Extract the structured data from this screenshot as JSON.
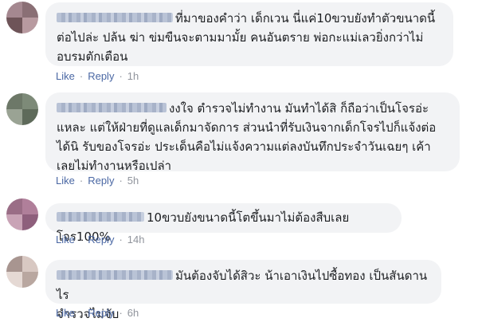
{
  "comments": [
    {
      "text": "ที่มาของคำว่า เด็กเวน นี่แค่10ขวบยังทำตัวขนาดนี้ ต่อไปล่ะ ปล้น ฆ่า ข่มขืนจะตามมามั้ย คนอันตราย พ่อกะแม่เลวยิ่งกว่าไม่อบรมตักเตือน",
      "like": "Like",
      "reply": "Reply",
      "time": "1h"
    },
    {
      "text": "งงใจ ตำรวจไม่ทำงาน มันทำได้สิ ก็ถือว่าเป็นโจรอ่ะ แหละ แต่ให้ฝ่ายที่ดูแลเด็กมาจัดการ ส่วนนำที่รับเงินจากเด็กโจรไปก็แจ้งต่อได้นิ รับของโจรอ่ะ ประเด็นคือไม่แจ้งความแต่ลงบันทึกประจำวันเฉยๆ เค้าเลยไม่ทำงานหรือเปล่า",
      "like": "Like",
      "reply": "Reply",
      "time": "5h"
    },
    {
      "text": "10ขวบยังขนาดนี้โตขึ้นมาไม่ต้องสืบเลยโจร100%",
      "like": "Like",
      "reply": "Reply",
      "time": "14h"
    },
    {
      "text": "มันต้องจับได้สิวะ น้าเอาเงินไปซื้อทอง เป็นสันดานไร จำรวจไม่จับ",
      "like": "Like",
      "reply": "Reply",
      "time": "6h"
    }
  ],
  "lines": {
    "c0": [
      "ที่มาของคำว่า เด็กเวน นี่แค่10ขวบยังทำตัวขนาดนี้",
      "ต่อไปล่ะ ปล้น ฆ่า ข่มขืนจะตามมามั้ย คนอันตราย พ่อกะแม่เลวยิ่งกว่าไม่",
      "อบรมตักเตือน"
    ],
    "c1": [
      "งงใจ ตำรวจไม่ทำงาน มันทำได้สิ ก็ถือว่าเป็นโจรอ่ะ",
      "แหละ แต่ให้ฝ่ายที่ดูแลเด็กมาจัดการ ส่วนนำที่รับเงินจากเด็กโจรไปก็แจ้งต่อ",
      "ได้นิ รับของโจรอ่ะ ประเด็นคือไม่แจ้งความแต่ลงบันทึกประจำวันเฉยๆ เค้า",
      "เลยไม่ทำงานหรือเปล่า"
    ],
    "c2": [
      "10ขวบยังขนาดนี้โตขึ้นมาไม่ต้องสืบเลยโจร100%"
    ],
    "c3": [
      "มันต้องจับได้สิวะ น้าเอาเงินไปซื้อทอง เป็นสันดานไร",
      "จำรวจไม่จับ"
    ]
  },
  "colors": {
    "link": "#4b68a4",
    "meta": "#90949c",
    "bubble": "#f2f3f5"
  }
}
